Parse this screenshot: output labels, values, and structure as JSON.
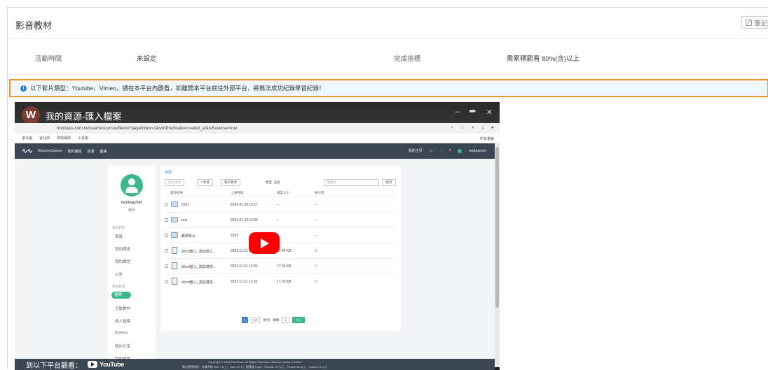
{
  "header": {
    "title": "影音教材",
    "note_label": "筆記"
  },
  "info": {
    "activity_time_label": "活動時間",
    "activity_time_value": "未設定",
    "completion_label": "完成指標",
    "completion_value": "需累積觀看 80%(含)以上"
  },
  "notice": {
    "text": "以下影片類型：Youtube、Vimeo，請在本平台內觀看，如離開本平台前往外部平台，將無法成功紀錄學習紀錄！"
  },
  "video": {
    "channel_initial": "W",
    "title": "我的資源-匯入檔案",
    "window_controls": [
      "–",
      "⮫",
      "✕"
    ],
    "url": "tronclass.com.tw/user/resources/files#/?pageIndex=1&sortPredicate=created_at&isReverse=true",
    "bookmarks": [
      "書本圖",
      "會社頭",
      "雲端硬碟",
      "工具箱"
    ],
    "bookmarks_right": "所有書籤",
    "app": {
      "logo": "WisdomGarden",
      "nav": [
        "WisdomGarden",
        "我的課程",
        "資源",
        "圖庫"
      ],
      "right": [
        "我的主頁",
        "testteacher"
      ],
      "user_name": "testteacher",
      "user_role": "教師",
      "sections": [
        {
          "label": "我的教學",
          "items": [
            "首頁",
            "我的課表",
            "我的課程",
            "公告"
          ]
        },
        {
          "label": "我的資源",
          "items": [
            "檔案",
            "互動教材",
            "個人題庫",
            "Rubrics",
            "我的分享",
            "我的模版"
          ]
        }
      ],
      "breadcrumb": "資源",
      "toolbar": {
        "bulk": "批次操作",
        "add": "+ 新增",
        "mine": "我的資源",
        "filter": "類型: 全部",
        "search_placeholder": "關鍵字",
        "search": "搜尋"
      },
      "columns": [
        "資源名稱",
        "上傳時間",
        "檔案大小",
        "被引用"
      ],
      "rows": [
        {
          "name": "0101",
          "time": "2024.01.29 15:17",
          "size": "--",
          "ref": "--",
          "type": "folder"
        },
        {
          "name": "test",
          "time": "2024.01.29 15:05",
          "size": "--",
          "ref": "--",
          "type": "folder"
        },
        {
          "name": "教學影片",
          "time": "2023",
          "size": "--",
          "ref": "--",
          "type": "folder"
        },
        {
          "name": "Word匯入_測試總上...",
          "time": "2023.11.21 12:04",
          "size": "16.44 KB",
          "ref": "0",
          "type": "file"
        },
        {
          "name": "Word匯入_測試選擇...",
          "time": "2023.11.21 12:03",
          "size": "17.56 KB",
          "ref": "0",
          "type": "file"
        },
        {
          "name": "Word匯入_測試選擇...",
          "time": "2023.11.21 11:56",
          "size": "17.56 KB",
          "ref": "0",
          "type": "file"
        }
      ],
      "pager": {
        "current": "1",
        "per_page": "20",
        "per_page_suffix": "項/頁",
        "goto_label": "跳轉",
        "goto_value": "1",
        "go": "Go"
      },
      "footer_1": "Copyright © 2023 TronClass. All Rights Reserved. Wisdom Garden Limited",
      "footer_2": "最佳瀏覽環境：作業系統 Win 7 以上、Mac OS X；瀏覽器 Edge、Chrome 90 以上、Firefox 56 以上、Safari 9.0 以上"
    },
    "watch_on": "到以下平台觀看：",
    "youtube_label": "YouTube"
  }
}
